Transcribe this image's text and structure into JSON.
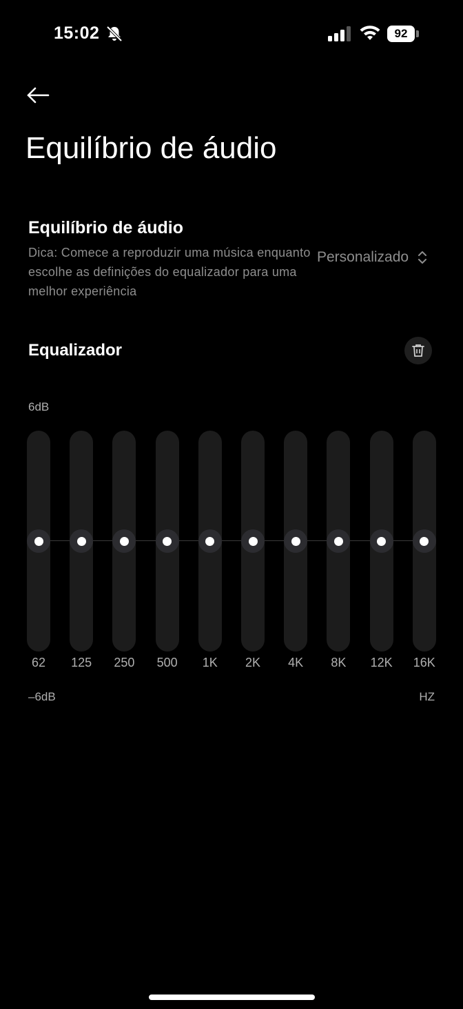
{
  "status_bar": {
    "time": "15:02",
    "battery": "92",
    "icons": [
      "bell-slash-icon",
      "signal-icon",
      "wifi-icon",
      "battery-icon"
    ]
  },
  "header": {
    "back_icon": "arrow-left-icon",
    "title": "Equilíbrio de áudio"
  },
  "balance": {
    "title": "Equilíbrio de áudio",
    "hint": "Dica: Comece a reproduzir uma música enquanto escolhe as definições do equalizador para uma melhor experiência",
    "preset": "Personalizado",
    "preset_icon": "chevron-up-down-icon"
  },
  "equalizer": {
    "title": "Equalizador",
    "reset_icon": "trash-icon",
    "max_label": "6dB",
    "min_label": "–6dB",
    "unit_label": "HZ",
    "bands": [
      {
        "label": "62",
        "gain_db": 0
      },
      {
        "label": "125",
        "gain_db": 0
      },
      {
        "label": "250",
        "gain_db": 0
      },
      {
        "label": "500",
        "gain_db": 0
      },
      {
        "label": "1K",
        "gain_db": 0
      },
      {
        "label": "2K",
        "gain_db": 0
      },
      {
        "label": "4K",
        "gain_db": 0
      },
      {
        "label": "8K",
        "gain_db": 0
      },
      {
        "label": "12K",
        "gain_db": 0
      },
      {
        "label": "16K",
        "gain_db": 0
      }
    ]
  },
  "colors": {
    "background": "#000000",
    "track": "#1c1c1c",
    "secondary_text": "#8e8e8e"
  }
}
